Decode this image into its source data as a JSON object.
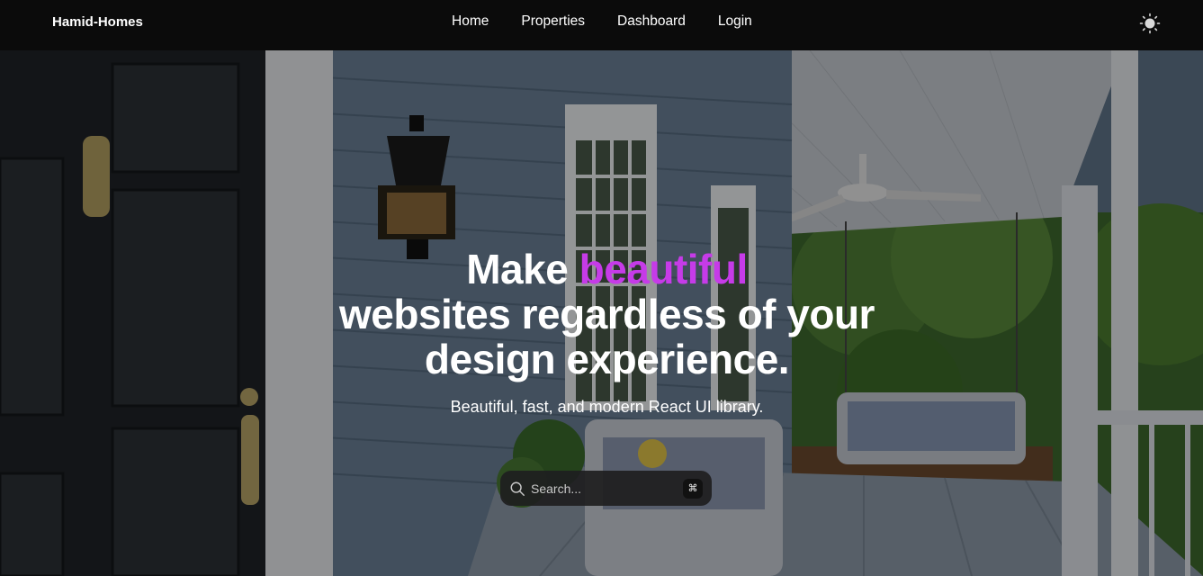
{
  "navbar": {
    "brand": "Hamid-Homes",
    "links": [
      {
        "label": "Home"
      },
      {
        "label": "Properties"
      },
      {
        "label": "Dashboard"
      },
      {
        "label": "Login"
      }
    ],
    "theme_toggle_icon": "sun-icon"
  },
  "hero": {
    "title_prefix": "Make ",
    "title_accent": "beautiful",
    "title_line2": "websites regardless of your",
    "title_line3": "design experience.",
    "subtitle": "Beautiful, fast, and modern React UI library.",
    "accent_color": "#c63be8",
    "background_image": "house-porch-photo",
    "search": {
      "placeholder": "Search...",
      "shortcut": "⌘",
      "icon": "search-icon"
    }
  }
}
